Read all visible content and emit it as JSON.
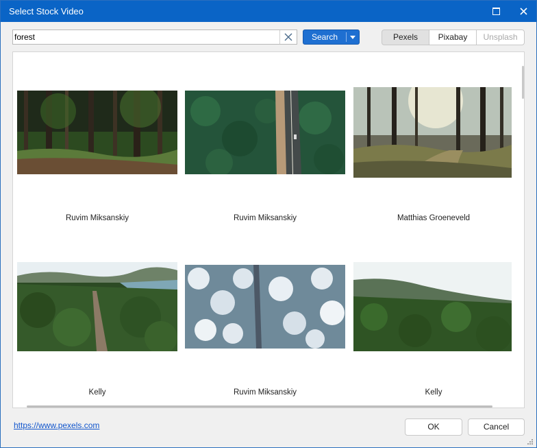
{
  "window": {
    "title": "Select Stock Video"
  },
  "search": {
    "value": "forest"
  },
  "buttons": {
    "search": "Search",
    "ok": "OK",
    "cancel": "Cancel"
  },
  "sources": [
    {
      "label": "Pexels",
      "state": "selected"
    },
    {
      "label": "Pixabay",
      "state": "normal"
    },
    {
      "label": "Unsplash",
      "state": "disabled"
    }
  ],
  "videos": [
    {
      "author": "Ruvim Miksanskiy",
      "scene": "dense dark forest with stream"
    },
    {
      "author": "Ruvim Miksanskiy",
      "scene": "aerial road through green forest"
    },
    {
      "author": "Matthias Groeneveld",
      "scene": "sunlit forest path"
    },
    {
      "author": "Kelly",
      "scene": "road through forest beside lake"
    },
    {
      "author": "Ruvim Miksanskiy",
      "scene": "aerial snowy forest"
    },
    {
      "author": "Kelly",
      "scene": "forest with mountain in distance"
    }
  ],
  "footer": {
    "link": "https://www.pexels.com"
  },
  "colors": {
    "accent": "#1e6fd1",
    "titlebar": "#0a64c6",
    "link": "#1155cc"
  }
}
